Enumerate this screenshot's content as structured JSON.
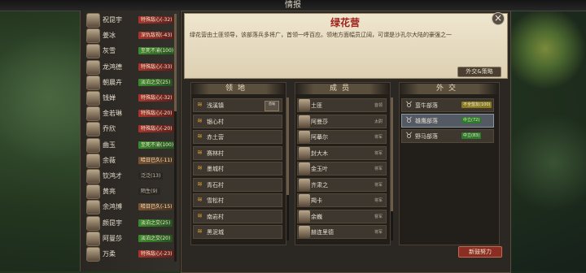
{
  "window_title": "情报",
  "left_list": [
    {
      "name": "祝昆宇",
      "tag": "特殊敌心(-32)",
      "tone": "red"
    },
    {
      "name": "姜冰",
      "tag": "深仇敌视(-43)",
      "tone": "red"
    },
    {
      "name": "灰雪",
      "tag": "至死不渝(100)",
      "tone": "green"
    },
    {
      "name": "龙鸿德",
      "tag": "特殊敌心(-33)",
      "tone": "red"
    },
    {
      "name": "朝晨卉",
      "tag": "淡泊之交(25)",
      "tone": "green"
    },
    {
      "name": "钱婵",
      "tag": "特殊敌心(-32)",
      "tone": "red"
    },
    {
      "name": "金若琳",
      "tag": "特殊敌心(-20)",
      "tone": "red"
    },
    {
      "name": "乔欣",
      "tag": "特殊敌心(-20)",
      "tone": "red"
    },
    {
      "name": "曲玉",
      "tag": "至死不渝(100)",
      "tone": "green"
    },
    {
      "name": "余薇",
      "tag": "哈日已久(-11)",
      "tone": "brown"
    },
    {
      "name": "钦鸿才",
      "tag": "泛泛(13)",
      "tone": "dark"
    },
    {
      "name": "黄亮",
      "tag": "陌生(9)",
      "tone": "dark"
    },
    {
      "name": "余鸿博",
      "tag": "哈日已久(-15)",
      "tone": "brown"
    },
    {
      "name": "颜昆宇",
      "tag": "淡泊之交(25)",
      "tone": "green"
    },
    {
      "name": "阿曼莎",
      "tag": "淡泊之交(20)",
      "tone": "green"
    },
    {
      "name": "万柔",
      "tag": "特殊敌心(-23)",
      "tone": "red"
    }
  ],
  "faction": {
    "name": "绿花营",
    "description": "绿花营由土匪领导，该部落兵多将广，首领一呼百应。领地方面幅员辽阔，可谓是沙孔尔大陆的豪强之一",
    "diplomacy_button": "外交&策略",
    "effort_button": "新鼓努力"
  },
  "territory": {
    "header": "领地",
    "rows": [
      "浅溪镇",
      "银心村",
      "赤土营",
      "赛林村",
      "墨城村",
      "青石村",
      "雪松村",
      "南岩村",
      "黑泥城"
    ],
    "first_badge": "首城"
  },
  "members": {
    "header": "成员",
    "rows": [
      {
        "name": "土匪",
        "role": "首领"
      },
      {
        "name": "阿曼莎",
        "role": "太尉"
      },
      {
        "name": "阿摹尔",
        "role": "将军"
      },
      {
        "name": "封大木",
        "role": "将军"
      },
      {
        "name": "金玉叶",
        "role": "将军"
      },
      {
        "name": "齐肃之",
        "role": "将军"
      },
      {
        "name": "羯卡",
        "role": "将军"
      },
      {
        "name": "余巍",
        "role": "督军"
      },
      {
        "name": "赫连里德",
        "role": "将军"
      }
    ]
  },
  "diplomacy": {
    "header": "外交",
    "rows": [
      {
        "name": "蛮牛部落",
        "tag": "不全盟友(100)",
        "tone": "y"
      },
      {
        "name": "雄鹰部落",
        "tag": "中立(72)",
        "tone": "g"
      },
      {
        "name": "野马部落",
        "tag": "中立(83)",
        "tone": "g"
      }
    ]
  }
}
